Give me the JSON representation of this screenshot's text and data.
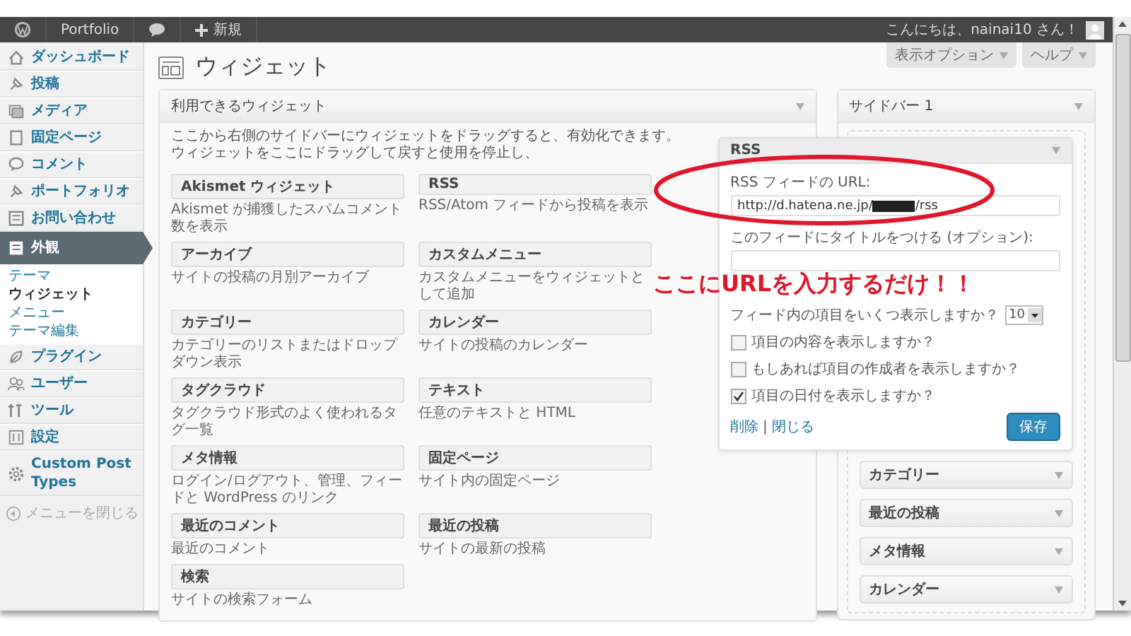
{
  "admin_bar": {
    "site": "Portfolio",
    "new": "新規",
    "greeting": "こんにちは、nainai10 さん！"
  },
  "menu": [
    {
      "label": "ダッシュボード",
      "selected": false
    },
    {
      "label": "投稿",
      "selected": false
    },
    {
      "label": "メディア",
      "selected": false
    },
    {
      "label": "固定ページ",
      "selected": false
    },
    {
      "label": "コメント",
      "selected": false
    },
    {
      "label": "ポートフォリオ",
      "selected": false
    },
    {
      "label": "お問い合わせ",
      "selected": false
    },
    {
      "label": "外観",
      "selected": true,
      "children": [
        {
          "label": "テーマ",
          "selected": false
        },
        {
          "label": "ウィジェット",
          "selected": true
        },
        {
          "label": "メニュー",
          "selected": false
        },
        {
          "label": "テーマ編集",
          "selected": false
        }
      ]
    },
    {
      "label": "プラグイン",
      "selected": false
    },
    {
      "label": "ユーザー",
      "selected": false
    },
    {
      "label": "ツール",
      "selected": false
    },
    {
      "label": "設定",
      "selected": false
    },
    {
      "label": "Custom Post Types",
      "selected": false
    },
    {
      "label": "メニューを閉じる",
      "selected": false,
      "kind": "collapse"
    }
  ],
  "page_title": "ウィジェット",
  "screen_tabs": [
    "表示オプション",
    "ヘルプ"
  ],
  "available": {
    "title": "利用できるウィジェット",
    "description": "ここから右側のサイドバーにウィジェットをドラッグすると、有効化できます。ウィジェットをここにドラッグして戻すと使用を停止し、",
    "widgets": [
      {
        "name": "Akismet ウィジェット",
        "description": "Akismet が捕獲したスパムコメント数を表示"
      },
      {
        "name": "RSS",
        "description": "RSS/Atom フィードから投稿を表示"
      },
      {
        "name": "アーカイブ",
        "description": "サイトの投稿の月別アーカイブ"
      },
      {
        "name": "カスタムメニュー",
        "description": "カスタムメニューをウィジェットとして追加"
      },
      {
        "name": "カテゴリー",
        "description": "カテゴリーのリストまたはドロップダウン表示"
      },
      {
        "name": "カレンダー",
        "description": "サイトの投稿のカレンダー"
      },
      {
        "name": "タグクラウド",
        "description": "タグクラウド形式のよく使われるタグ一覧"
      },
      {
        "name": "テキスト",
        "description": "任意のテキストと HTML"
      },
      {
        "name": "メタ情報",
        "description": "ログイン/ログアウト、管理、フィードと WordPress のリンク"
      },
      {
        "name": "固定ページ",
        "description": "サイト内の固定ページ"
      },
      {
        "name": "最近のコメント",
        "description": "最近のコメント"
      },
      {
        "name": "最近の投稿",
        "description": "サイトの最新の投稿"
      },
      {
        "name": "検索",
        "description": "サイトの検索フォーム"
      }
    ]
  },
  "sidebar": {
    "title": "サイドバー 1",
    "widgets": [
      {
        "name": "RSS",
        "expanded": true,
        "url_label": "RSS フィードの URL:",
        "url_start": "http://d.hatena.ne.jp/",
        "url_end": "/rss",
        "title_label": "このフィードにタイトルをつける (オプション):",
        "count_label": "フィード内の項目をいくつ表示しますか？",
        "count": "10",
        "options": [
          {
            "label": "項目の内容を表示しますか？",
            "checked": false
          },
          {
            "label": "もしあれば項目の作成者を表示しますか？",
            "checked": false
          },
          {
            "label": "項目の日付を表示しますか？",
            "checked": true
          }
        ],
        "delete": "削除",
        "separator": "|",
        "close": "閉じる",
        "save": "保存"
      },
      {
        "name": "カテゴリー",
        "expanded": false
      },
      {
        "name": "最近の投稿",
        "expanded": false
      },
      {
        "name": "メタ情報",
        "expanded": false
      },
      {
        "name": "カレンダー",
        "expanded": false
      }
    ]
  },
  "annotation": {
    "text": "ここにURLを入力するだけ！！"
  }
}
